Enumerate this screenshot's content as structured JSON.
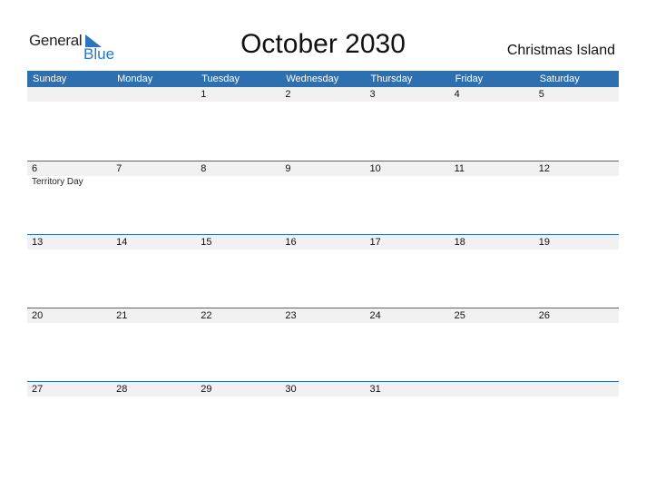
{
  "logo": {
    "general": "General",
    "blue": "Blue",
    "icon": "triangle-flag-icon"
  },
  "title": "October 2030",
  "country": "Christmas Island",
  "colors": {
    "header_bg": "#2e6fb0",
    "date_strip": "#f1f1f1",
    "logo_blue": "#2a76c6"
  },
  "weekdays": [
    "Sunday",
    "Monday",
    "Tuesday",
    "Wednesday",
    "Thursday",
    "Friday",
    "Saturday"
  ],
  "weeks": [
    {
      "days": [
        "",
        "",
        "1",
        "2",
        "3",
        "4",
        "5"
      ],
      "events": [
        "",
        "",
        "",
        "",
        "",
        "",
        ""
      ]
    },
    {
      "days": [
        "6",
        "7",
        "8",
        "9",
        "10",
        "11",
        "12"
      ],
      "events": [
        "Territory Day",
        "",
        "",
        "",
        "",
        "",
        ""
      ]
    },
    {
      "days": [
        "13",
        "14",
        "15",
        "16",
        "17",
        "18",
        "19"
      ],
      "events": [
        "",
        "",
        "",
        "",
        "",
        "",
        ""
      ]
    },
    {
      "days": [
        "20",
        "21",
        "22",
        "23",
        "24",
        "25",
        "26"
      ],
      "events": [
        "",
        "",
        "",
        "",
        "",
        "",
        ""
      ]
    },
    {
      "days": [
        "27",
        "28",
        "29",
        "30",
        "31",
        "",
        ""
      ],
      "events": [
        "",
        "",
        "",
        "",
        "",
        "",
        ""
      ]
    }
  ]
}
